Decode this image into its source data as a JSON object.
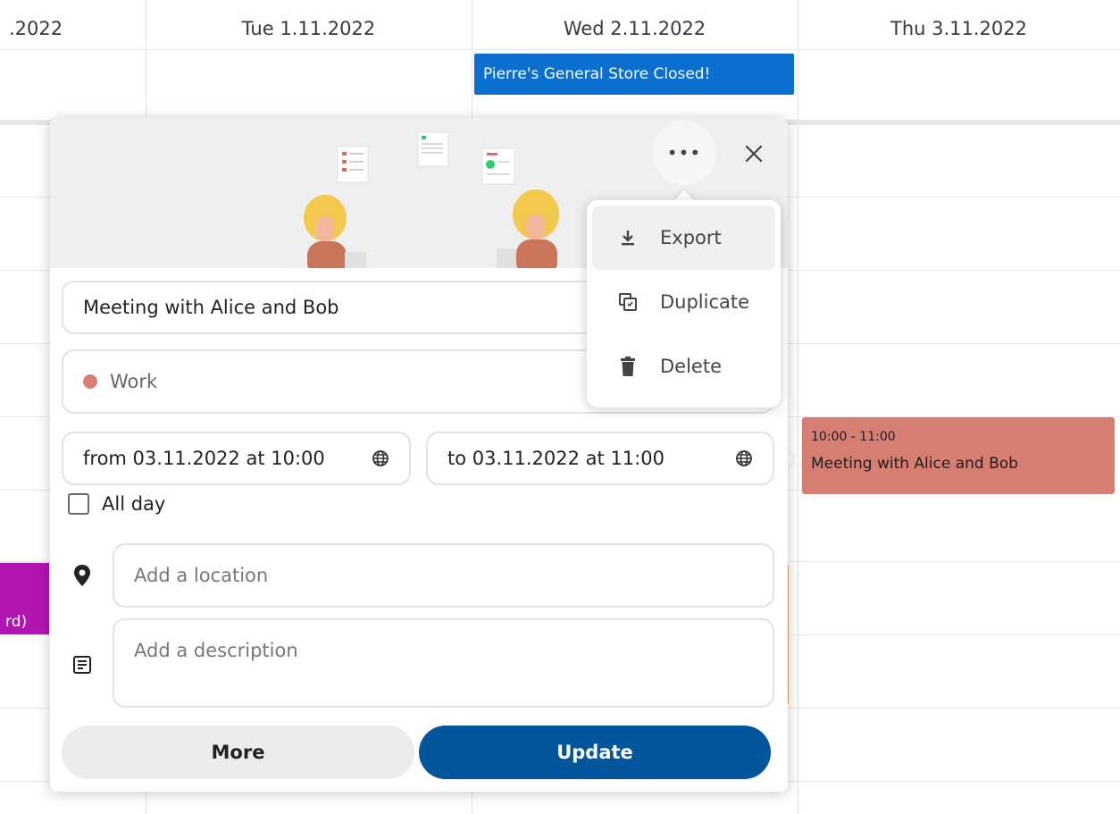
{
  "calendar": {
    "columns": [
      {
        "label": ".2022"
      },
      {
        "label": "Tue 1.11.2022"
      },
      {
        "label": "Wed 2.11.2022"
      },
      {
        "label": "Thu 3.11.2022"
      }
    ],
    "allday_event": {
      "title": "Pierre's General Store Closed!",
      "color": "#0a6fcf"
    },
    "purple_event": {
      "text": "rd)",
      "color": "#b315b3"
    },
    "meeting_event": {
      "time": "10:00 - 11:00",
      "title": "Meeting with Alice and Bob",
      "color": "#d67e72"
    }
  },
  "popover": {
    "more_icon": "more-horizontal-icon",
    "close_icon": "close-icon",
    "title_value": "Meeting with Alice and Bob",
    "calendar": {
      "name": "Work",
      "color": "#d67e72"
    },
    "from": "from 03.11.2022 at 10:00",
    "to": "to 03.11.2022 at 11:00",
    "all_day": {
      "label": "All day",
      "checked": false
    },
    "location_placeholder": "Add a location",
    "description_placeholder": "Add a description",
    "buttons": {
      "more": "More",
      "update": "Update"
    }
  },
  "menu": {
    "items": [
      {
        "label": "Export",
        "icon": "download-icon",
        "active": true
      },
      {
        "label": "Duplicate",
        "icon": "duplicate-icon",
        "active": false
      },
      {
        "label": "Delete",
        "icon": "trash-icon",
        "active": false
      }
    ]
  },
  "colors": {
    "accent": "#03559c",
    "event_blue": "#0a6fcf"
  }
}
